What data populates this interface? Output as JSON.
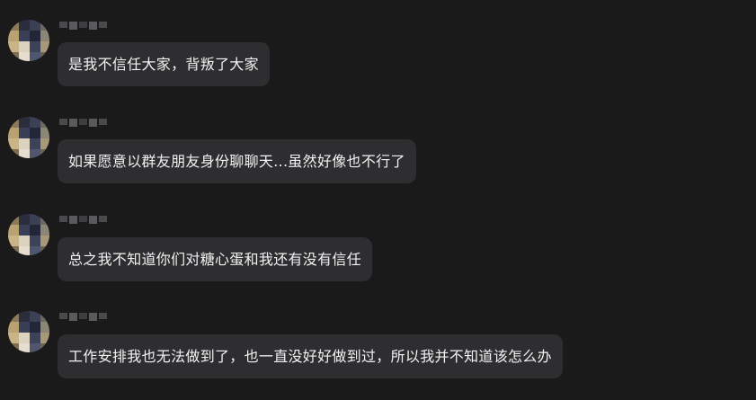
{
  "colors": {
    "background": "#1a1a1b",
    "bubble": "#2e2e31",
    "text": "#f2f2f2"
  },
  "messages": [
    {
      "text": "是我不信任大家，背叛了大家"
    },
    {
      "text": "如果愿意以群友朋友身份聊聊天...虽然好像也不行了"
    },
    {
      "text": "总之我不知道你们对糖心蛋和我还有没有信任"
    },
    {
      "text": "工作安排我也无法做到了，也一直没好好做到过，所以我并不知道该怎么办"
    }
  ]
}
